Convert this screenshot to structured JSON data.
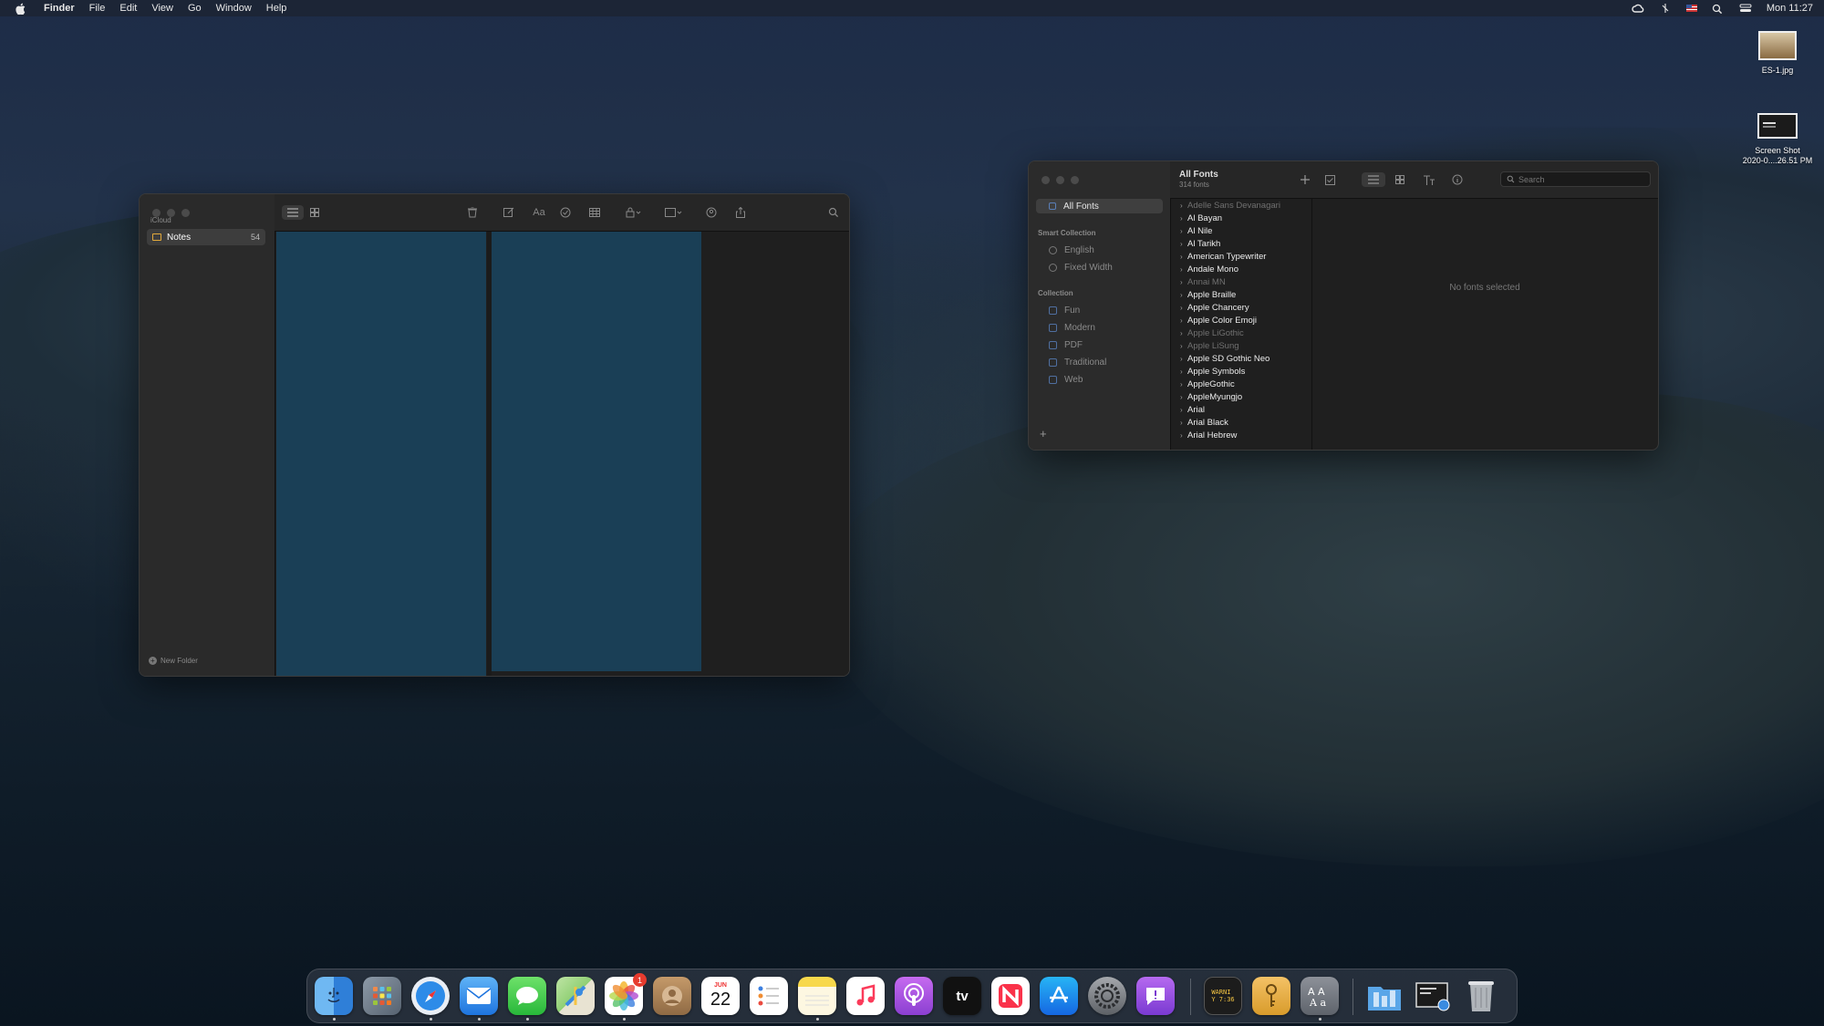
{
  "menubar": {
    "app": "Finder",
    "items": [
      "File",
      "Edit",
      "View",
      "Go",
      "Window",
      "Help"
    ],
    "clock": "Mon 11:27",
    "status_icons": [
      "creative-cloud-icon",
      "bluetooth-icon",
      "us-flag-icon",
      "spotlight-icon",
      "control-center-icon"
    ]
  },
  "desktop": {
    "files": [
      {
        "name": "ES-1.jpg"
      },
      {
        "line1": "Screen Shot",
        "line2": "2020-0....26.51 PM"
      }
    ]
  },
  "notes_window": {
    "account": "iCloud",
    "folder": {
      "label": "Notes",
      "count": "54"
    },
    "new_folder": "New Folder",
    "list_bg": "#1a3f56"
  },
  "fontbook": {
    "sidebar": {
      "all_fonts": "All Fonts",
      "smart_header": "Smart Collection",
      "smart_items": [
        "English",
        "Fixed Width"
      ],
      "collection_header": "Collection",
      "collections": [
        "Fun",
        "Modern",
        "PDF",
        "Traditional",
        "Web"
      ]
    },
    "header": {
      "title": "All Fonts",
      "subtitle": "314 fonts",
      "search_placeholder": "Search"
    },
    "fonts": [
      {
        "name": "Adelle Sans Devanagari",
        "enabled": false
      },
      {
        "name": "Al Bayan",
        "enabled": true
      },
      {
        "name": "Al Nile",
        "enabled": true
      },
      {
        "name": "Al Tarikh",
        "enabled": true
      },
      {
        "name": "American Typewriter",
        "enabled": true
      },
      {
        "name": "Andale Mono",
        "enabled": true
      },
      {
        "name": "Annai MN",
        "enabled": false
      },
      {
        "name": "Apple Braille",
        "enabled": true
      },
      {
        "name": "Apple Chancery",
        "enabled": true
      },
      {
        "name": "Apple Color Emoji",
        "enabled": true
      },
      {
        "name": "Apple LiGothic",
        "enabled": false
      },
      {
        "name": "Apple LiSung",
        "enabled": false
      },
      {
        "name": "Apple SD Gothic Neo",
        "enabled": true
      },
      {
        "name": "Apple Symbols",
        "enabled": true
      },
      {
        "name": "AppleGothic",
        "enabled": true
      },
      {
        "name": "AppleMyungjo",
        "enabled": true
      },
      {
        "name": "Arial",
        "enabled": true
      },
      {
        "name": "Arial Black",
        "enabled": true
      },
      {
        "name": "Arial Hebrew",
        "enabled": true
      }
    ],
    "empty_message": "No fonts selected"
  },
  "dock": {
    "calendar": {
      "month": "JUN",
      "day": "22"
    },
    "photos_badge": "1",
    "console_text": "WARNI\nY 7:36",
    "apps": [
      "Finder",
      "Launchpad",
      "Safari",
      "Mail",
      "Messages",
      "Maps",
      "Photos",
      "Contacts",
      "Calendar",
      "Reminders",
      "Notes",
      "Music",
      "Podcasts",
      "TV",
      "News",
      "App Store",
      "System Preferences",
      "Feedback Assistant",
      "Console",
      "Keychain Access",
      "Font Book",
      "Downloads",
      "Screenshots",
      "Trash"
    ],
    "tv_label": "tv"
  }
}
